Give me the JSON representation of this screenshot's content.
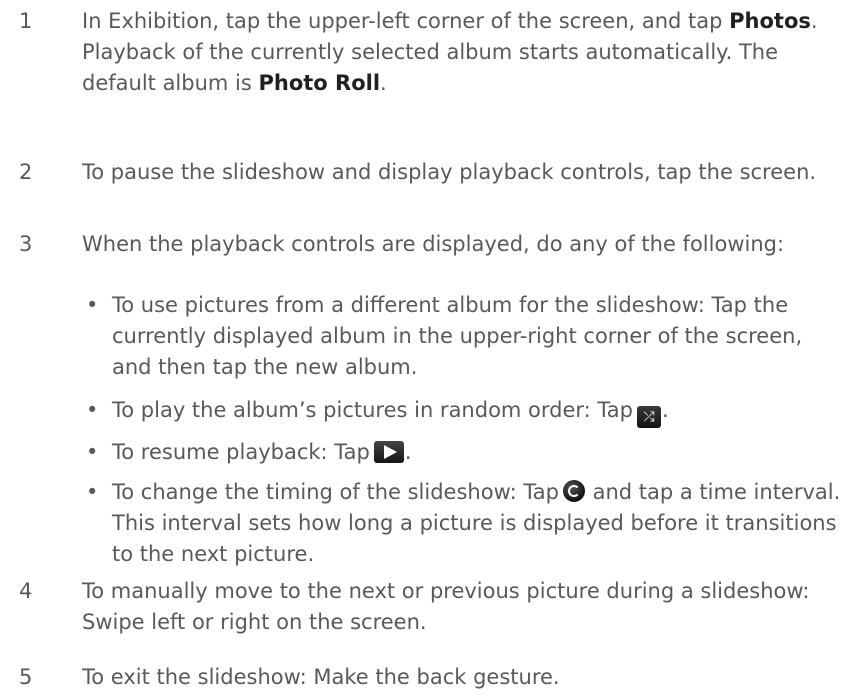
{
  "steps": [
    {
      "number": "1",
      "text_a": "In Exhibition, tap the upper-left corner of the screen, and tap ",
      "bold_a": "Photos",
      "text_b": ". Playback of the currently selected album starts automatically. The default album is ",
      "bold_b": "Photo Roll",
      "text_c": "."
    },
    {
      "number": "2",
      "text": "To pause the slideshow and display playback controls, tap the screen."
    },
    {
      "number": "3",
      "text": "When the playback controls are displayed, do any of the following:"
    },
    {
      "number": "4",
      "text": "To manually move to the next or previous picture during a slideshow: Swipe left or right on the screen."
    },
    {
      "number": "5",
      "text": "To exit the slideshow: Make the back gesture."
    }
  ],
  "bullets": [
    {
      "text": "To use pictures from a different album for the slideshow: Tap the currently displayed album in the upper-right corner of the screen, and then tap the new album."
    },
    {
      "text_before": "To play the album’s pictures in random order: Tap",
      "text_after": ".",
      "icon": "shuffle-icon"
    },
    {
      "text_before": "To resume playback: Tap",
      "text_after": ".",
      "icon": "play-icon"
    },
    {
      "text_before": "To change the timing of the slideshow: Tap",
      "text_after": "and tap a time interval. This interval sets how long a picture is displayed before it transitions to the next picture.",
      "icon": "timer-icon"
    }
  ],
  "bullet_glyph": "•",
  "colors": {
    "body_text": "#58595b",
    "bold_text": "#231f20"
  }
}
